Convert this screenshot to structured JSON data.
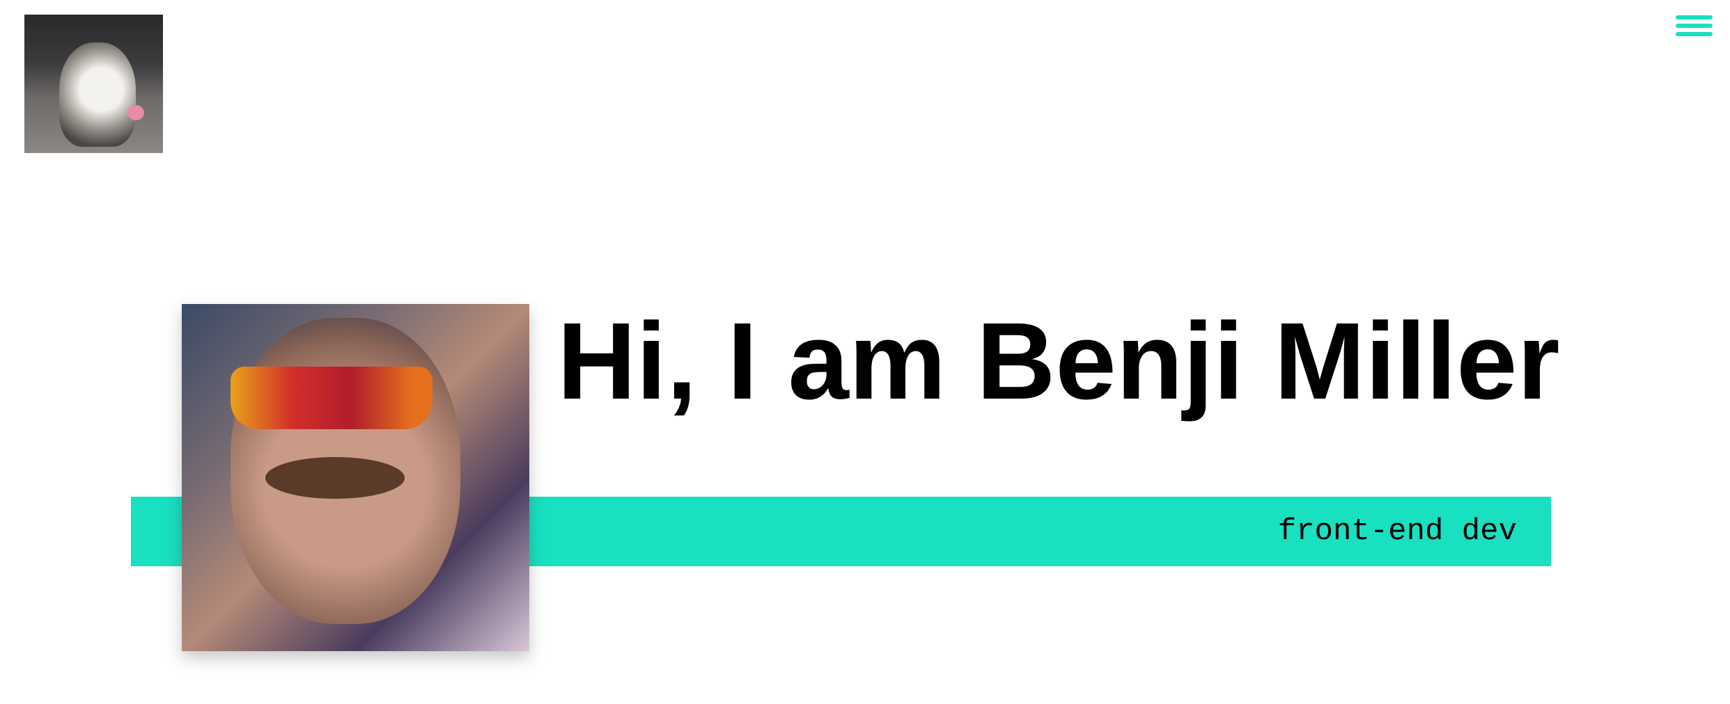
{
  "header": {
    "logo_icon": "husky-dog-photo",
    "menu_icon": "hamburger-menu-icon"
  },
  "hero": {
    "greeting": "Hi, I am",
    "name": "Benji Miller",
    "role": "front-end dev",
    "portrait": "profile-photo"
  },
  "colors": {
    "accent": "#19e0c0",
    "text": "#000000",
    "background": "#ffffff"
  }
}
